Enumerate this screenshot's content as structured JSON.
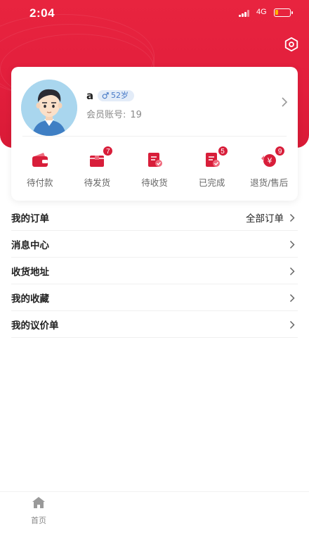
{
  "status_bar": {
    "time": "2:04",
    "network": "4G",
    "battery_level": 0.2
  },
  "header": {
    "settings_icon": "settings-hexagon-icon",
    "accent_color": "#e3223e"
  },
  "profile": {
    "name": "a",
    "age_label": "52岁",
    "gender_icon": "male-icon",
    "member_label": "会员账号:",
    "member_id": "19"
  },
  "order_status": [
    {
      "label": "待付款",
      "icon": "wallet-icon",
      "badge": ""
    },
    {
      "label": "待发货",
      "icon": "package-icon",
      "badge": "7"
    },
    {
      "label": "待收货",
      "icon": "receive-document-icon",
      "badge": ""
    },
    {
      "label": "已完成",
      "icon": "completed-document-icon",
      "badge": "5"
    },
    {
      "label": "退货/售后",
      "icon": "refund-icon",
      "badge": "9"
    }
  ],
  "menu": {
    "my_orders": "我的订单",
    "all_orders": "全部订单",
    "messages": "消息中心",
    "address": "收货地址",
    "favorites": "我的收藏",
    "quotes": "我的议价单"
  },
  "tabbar": {
    "home": "首页"
  }
}
